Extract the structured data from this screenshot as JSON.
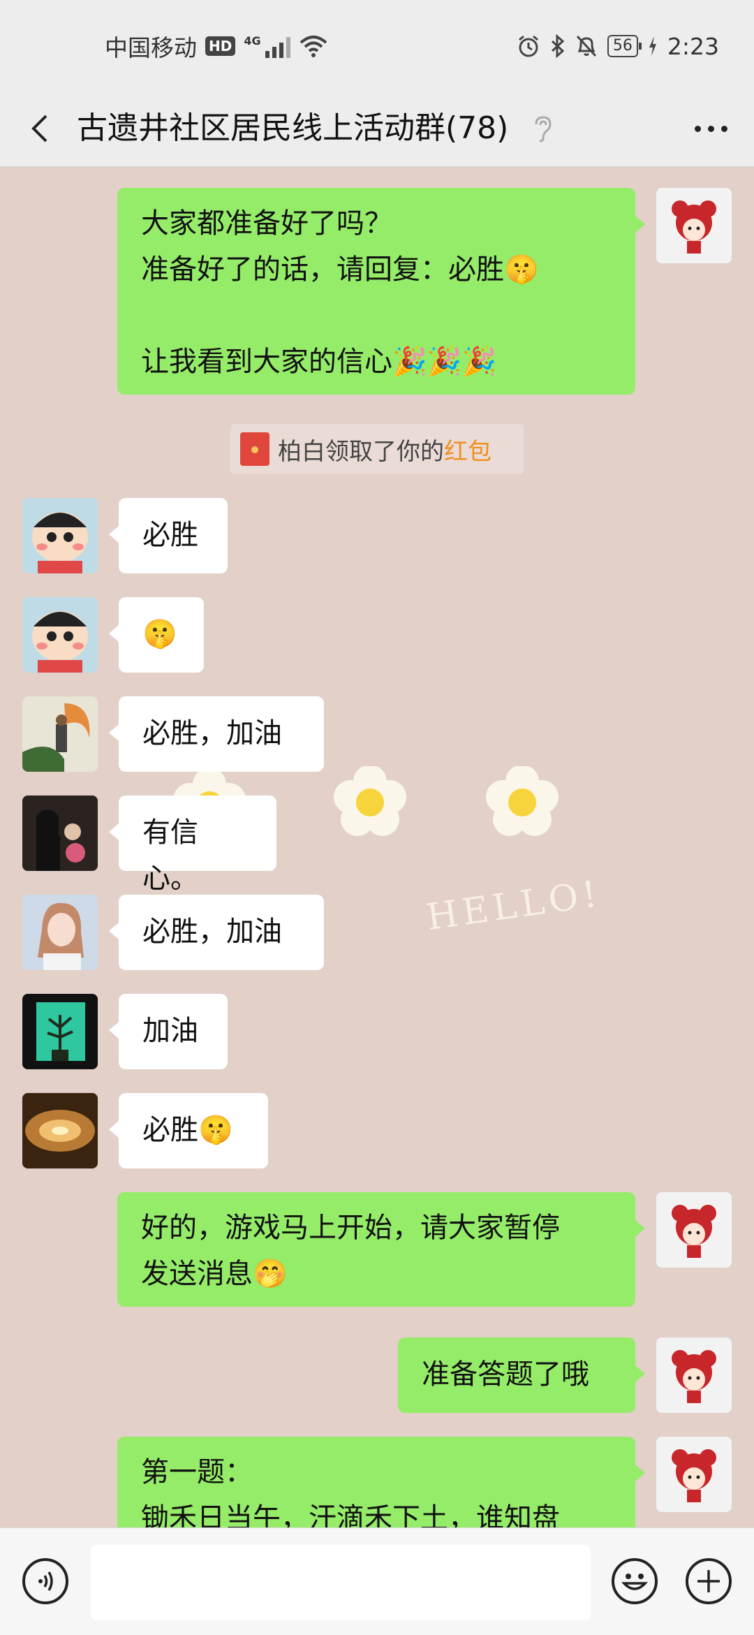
{
  "status_bar": {
    "carrier": "中国移动",
    "hd": "HD",
    "network": "4G",
    "battery": "56",
    "time": "2:23"
  },
  "nav": {
    "title": "古遗井社区居民线上活动群(78)",
    "back_icon": "chevron-left-icon",
    "ear_icon": "ear-icon",
    "more_icon": "more-dots-icon"
  },
  "messages": [
    {
      "side": "right",
      "lines": [
        "大家都准备好了吗？",
        "准备好了的话，请回复：必胜🤫",
        "",
        "让我看到大家的信心🎉🎉🎉"
      ]
    },
    {
      "side": "left",
      "lines": [
        "必胜"
      ]
    },
    {
      "side": "left",
      "lines": [
        "🤫"
      ]
    },
    {
      "side": "left",
      "lines": [
        "必胜，加油"
      ]
    },
    {
      "side": "left",
      "lines": [
        "有信心。"
      ]
    },
    {
      "side": "left",
      "lines": [
        "必胜，加油"
      ]
    },
    {
      "side": "left",
      "lines": [
        "加油"
      ]
    },
    {
      "side": "left",
      "lines": [
        "必胜🤫"
      ]
    },
    {
      "side": "right",
      "lines": [
        "好的，游戏马上开始，请大家暂停",
        "发送消息🤭"
      ]
    },
    {
      "side": "right",
      "lines": [
        "准备答题了哦"
      ]
    },
    {
      "side": "right",
      "lines": [
        "第一题：",
        "锄禾日当午，汗滴禾下土，谁知盘"
      ]
    }
  ],
  "system_notice": {
    "prefix": "柏白领取了你的",
    "link": "红包"
  },
  "sticker": {
    "text": "HELLO!"
  },
  "input_bar": {
    "placeholder": "",
    "voice_icon": "voice-icon",
    "emoji_icon": "emoji-icon",
    "plus_icon": "plus-icon"
  },
  "colors": {
    "chat_bg": "#e2d0c9",
    "self_bubble": "#95ec69",
    "other_bubble": "#ffffff",
    "link": "#f08f1d"
  }
}
